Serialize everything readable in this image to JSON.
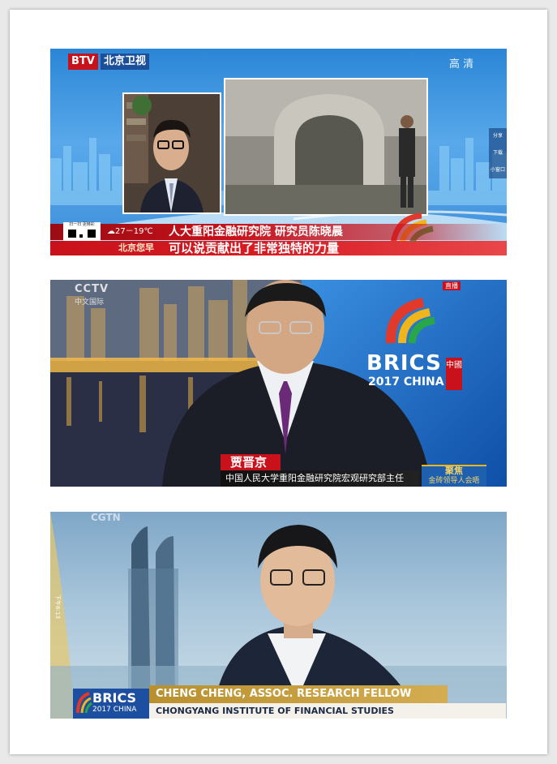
{
  "frame1": {
    "btv": "BTV",
    "channel": "北京卫视",
    "hd": "高 清",
    "weather": "☁27－19℃",
    "caption_name": "人大重阳金融研究院 研究员陈晓晨",
    "caption_quote": "可以说贡献出了非常独特的力量",
    "program_logo": "北京您早",
    "qr_text": "扫一扫 更精彩",
    "side_labels": [
      "分享",
      "下载",
      "小窗口"
    ]
  },
  "frame2": {
    "cctv": "CCTV",
    "cctv_sub": "中文国际",
    "brics": "BRICS",
    "brics_year": "2017 CHINA",
    "china_seal": "中國",
    "live_badge": "直播",
    "name": "贾晋京",
    "title": "中国人民大学重阳金融研究院宏观研究部主任",
    "ticker_top": "聚焦",
    "ticker_bottom": "金砖领导人会晤"
  },
  "frame3": {
    "cctv": "CGTN",
    "side_time": "下午6:13",
    "brics": "BRICS",
    "brics_year": "2017 CHINA",
    "name": "CHENG CHENG, ASSOC. RESEARCH FELLOW",
    "org": "CHONGYANG INSTITUTE OF FINANCIAL STUDIES"
  },
  "colors": {
    "btv_red": "#c8111a",
    "gold": "#c9a44a",
    "brics_blue": "#1e6fc8"
  }
}
